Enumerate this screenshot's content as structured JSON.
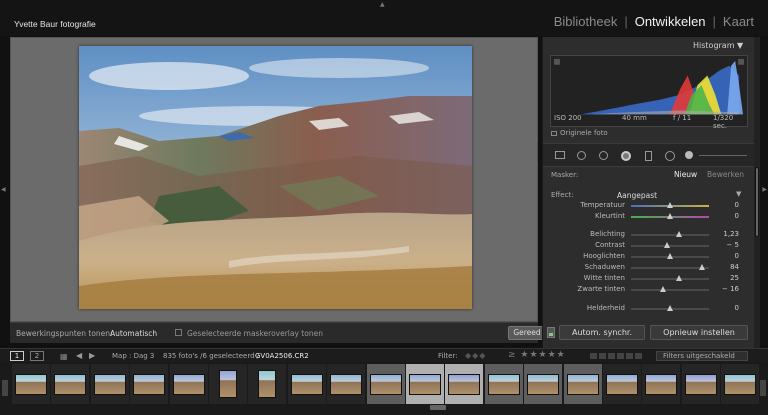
{
  "brand": "Yvette Baur fotografie",
  "modules": [
    {
      "label": "Bibliotheek",
      "active": false
    },
    {
      "label": "Ontwikkelen",
      "active": true
    },
    {
      "label": "Kaart",
      "active": false
    }
  ],
  "histogram": {
    "title": "Histogram",
    "iso": "ISO 200",
    "focal": "40 mm",
    "aperture": "f / 11",
    "shutter": "1/320 sec.",
    "original_label": "Originele foto"
  },
  "mask": {
    "label": "Masker:",
    "new_label": "Nieuw",
    "edit_label": "Bewerken"
  },
  "effect": {
    "label": "Effect:",
    "value": "Aangepast"
  },
  "sliders": [
    {
      "label": "Temperatuur",
      "value": "0",
      "pos": 0.5,
      "track": "temp"
    },
    {
      "label": "Kleurtint",
      "value": "0",
      "pos": 0.5,
      "track": "tint"
    },
    {
      "label": "Belichting",
      "value": "1,23",
      "pos": 0.62,
      "track": "plain"
    },
    {
      "label": "Contrast",
      "value": "− 5",
      "pos": 0.47,
      "track": "plain"
    },
    {
      "label": "Hooglichten",
      "value": "0",
      "pos": 0.5,
      "track": "plain"
    },
    {
      "label": "Schaduwen",
      "value": "84",
      "pos": 0.92,
      "track": "plain"
    },
    {
      "label": "Witte tinten",
      "value": "25",
      "pos": 0.62,
      "track": "plain"
    },
    {
      "label": "Zwarte tinten",
      "value": "− 16",
      "pos": 0.42,
      "track": "plain"
    },
    {
      "label": "Helderheid",
      "value": "0",
      "pos": 0.5,
      "track": "plain"
    }
  ],
  "toolbar": {
    "label": "Bewerkingspunten tonen:",
    "select": "Automatisch",
    "overlay_label": "Geselecteerde maskeroverlay tonen",
    "done_label": "Gereed"
  },
  "buttons": {
    "sync_label": "Autom. synchr.",
    "reset_label": "Opnieuw instellen"
  },
  "filmstrip_header": {
    "page1": "1",
    "page2": "2",
    "source": "Map : Dag 3",
    "count": "835 foto's /6 geselecteerd /",
    "filename": "GV0A2506.CR2",
    "filter_label": "Filter:",
    "filter_set": "Filters uitgeschakeld"
  },
  "colors": {
    "accent_green": "#7ec27e",
    "panel_bg": "#2d2d2d"
  }
}
